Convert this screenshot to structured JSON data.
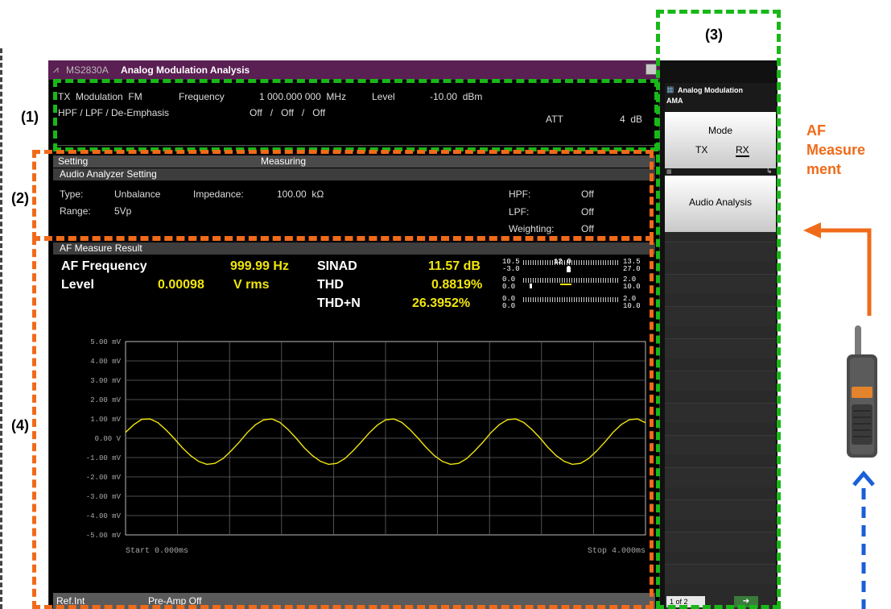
{
  "title_bar": {
    "brand": "MS2830A",
    "app": "Analog Modulation Analysis"
  },
  "params": {
    "tx_modulation": "TX  Modulation  FM",
    "frequency_label": "Frequency",
    "frequency_value": "1 000.000 000  MHz",
    "level_label": "Level",
    "level_value": "-10.00  dBm",
    "filters_label": "HPF / LPF / De-Emphasis",
    "filters_value": "Off   /   Off   /   Off",
    "att_label": "ATT",
    "att_value": "4  dB"
  },
  "setting_bar": {
    "left": "Setting",
    "center": "Measuring"
  },
  "audio": {
    "header": "Audio Analyzer Setting",
    "type_label": "Type:",
    "type_value": "Unbalance",
    "impedance_label": "Impedance:",
    "impedance_value": "100.00  kΩ",
    "range_label": "Range:",
    "range_value": "5Vp",
    "hpf_label": "HPF:",
    "hpf_value": "Off",
    "lpf_label": "LPF:",
    "lpf_value": "Off",
    "weight_label": "Weighting:",
    "weight_value": "Off"
  },
  "result": {
    "header": "AF Measure Result",
    "af_label": "AF Frequency",
    "af_value": "999.99 Hz",
    "level_label": "Level",
    "level_value": "0.00098",
    "level_unit": "V rms",
    "sinad_label": "SINAD",
    "sinad_value": "11.57 dB",
    "thd_label": "THD",
    "thd_value": "0.8819%",
    "thdn_label": "THD+N",
    "thdn_value": "26.3952%"
  },
  "scales": {
    "r1_l_top": "10.5",
    "r1_l_bot": "-3.0",
    "r1_mid": "12.0",
    "r1_r_top": "13.5",
    "r1_r_bot": "27.0",
    "r2_l_top": "0.0",
    "r2_l_bot": "0.0",
    "r2_r_top": "2.0",
    "r2_r_bot": "10.0",
    "r3_l_top": "0.0",
    "r3_l_bot": "0.0",
    "r3_r_top": "2.0",
    "r3_r_bot": "10.0"
  },
  "waveform": {
    "y_ticks": [
      "5.00 mV",
      "4.00 mV",
      "3.00 mV",
      "2.00 mV",
      "1.00 mV",
      "0.00  V",
      "-1.00 mV",
      "-2.00 mV",
      "-3.00 mV",
      "-4.00 mV",
      "-5.00 mV"
    ],
    "start": "Start 0.000ms",
    "stop": "Stop 4.000ms",
    "trace_color": "#f2e60f"
  },
  "chart_data": {
    "type": "line",
    "x_range_ms": [
      0,
      4
    ],
    "ylim_mV": [
      -5,
      5
    ],
    "series": [
      {
        "x": [
          0,
          0.0625,
          0.125,
          0.1875,
          0.25,
          0.3125,
          0.375,
          0.4375,
          0.5,
          0.5625,
          0.625,
          0.6875,
          0.75,
          0.8125,
          0.875,
          0.9375,
          1.0,
          1.0625,
          1.125,
          1.1875,
          1.25,
          1.3125,
          1.375,
          1.4375,
          1.5,
          1.5625,
          1.625,
          1.6875,
          1.75,
          1.8125,
          1.875,
          1.9375,
          2.0,
          2.0625,
          2.125,
          2.1875,
          2.25,
          2.3125,
          2.375,
          2.4375,
          2.5,
          2.5625,
          2.625,
          2.6875,
          2.75,
          2.8125,
          2.875,
          2.9375,
          3.0,
          3.0625,
          3.125,
          3.1875,
          3.25,
          3.3125,
          3.375,
          3.4375,
          3.5,
          3.5625,
          3.625,
          3.6875,
          3.75,
          3.8125,
          3.875,
          3.9375,
          4.0
        ],
        "y": [
          0.3,
          0.7,
          0.98,
          1.0,
          0.8,
          0.42,
          -0.02,
          -0.5,
          -0.9,
          -1.2,
          -1.35,
          -1.3,
          -1.05,
          -0.65,
          -0.2,
          0.3,
          0.7,
          0.95,
          1.0,
          0.82,
          0.45,
          0.0,
          -0.5,
          -0.9,
          -1.2,
          -1.35,
          -1.3,
          -1.05,
          -0.65,
          -0.2,
          0.28,
          0.68,
          0.95,
          1.0,
          0.82,
          0.45,
          0.0,
          -0.48,
          -0.9,
          -1.2,
          -1.35,
          -1.3,
          -1.05,
          -0.65,
          -0.2,
          0.3,
          0.7,
          0.96,
          1.0,
          0.82,
          0.46,
          0.02,
          -0.48,
          -0.9,
          -1.2,
          -1.35,
          -1.3,
          -1.05,
          -0.66,
          -0.2,
          0.3,
          0.7,
          0.96,
          1.0,
          0.8
        ]
      }
    ]
  },
  "status_bar": {
    "ref": "Ref.Int",
    "preamp": "Pre-Amp Off"
  },
  "softkeys": {
    "header_line1": "Analog Modulation",
    "header_line2": "AMA",
    "mode_label": "Mode",
    "mode_tx": "TX",
    "mode_rx": "RX",
    "audio_analysis": "Audio Analysis",
    "page": "1 of 2",
    "next": "➔"
  },
  "annotations": {
    "label1": "(1)",
    "label2": "(2)",
    "label3": "(3)",
    "label4": "(4)",
    "af_line1": "AF",
    "af_line2": "Measure",
    "af_line3": "ment"
  }
}
